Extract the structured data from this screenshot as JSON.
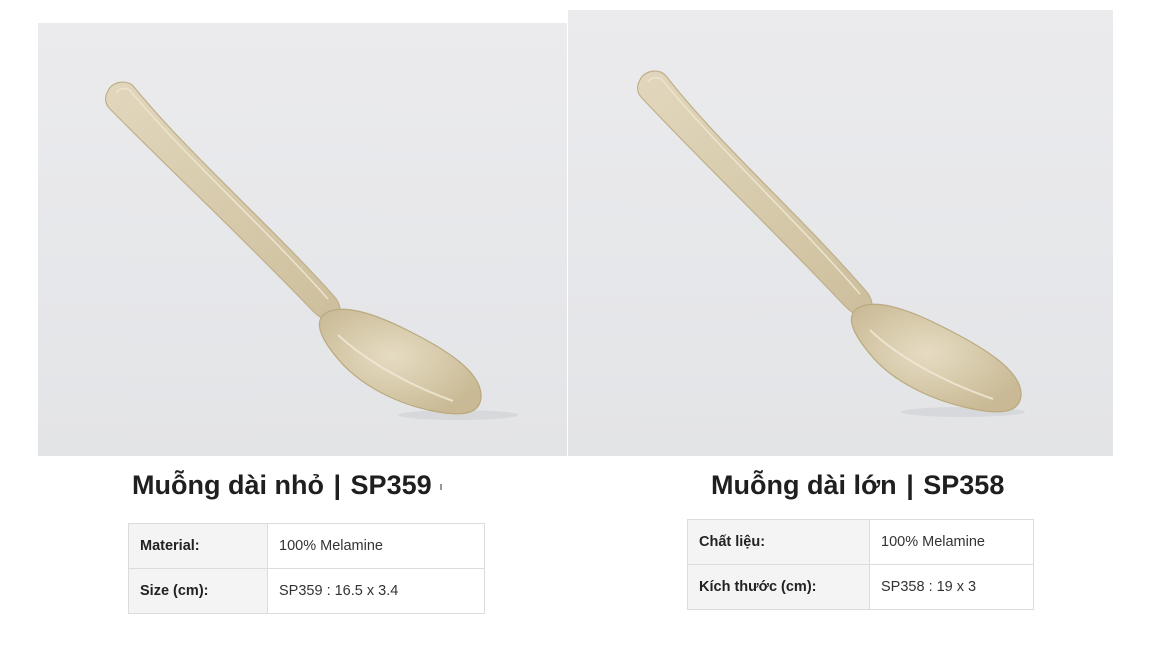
{
  "products": [
    {
      "name": "Muỗng dài nhỏ",
      "separator": "|",
      "code": "SP359",
      "image_alt": "Beige melamine long spoon, small",
      "specs": [
        {
          "label": "Material:",
          "value": "100% Melamine"
        },
        {
          "label": "Size (cm):",
          "value": "SP359 : 16.5 x 3.4"
        }
      ]
    },
    {
      "name": "Muỗng dài lớn",
      "separator": "|",
      "code": "SP358",
      "image_alt": "Beige melamine long spoon, large",
      "specs": [
        {
          "label": "Chất liệu:",
          "value": "100% Melamine"
        },
        {
          "label": "Kích thước (cm):",
          "value": "SP358 : 19 x 3"
        }
      ]
    }
  ],
  "colors": {
    "spoon": "#d9cdb0",
    "spoon_shadow": "#c4b690",
    "photo_bg": "#e8e9eb",
    "table_key_bg": "#f4f4f4",
    "table_border": "#dcdcdc"
  }
}
